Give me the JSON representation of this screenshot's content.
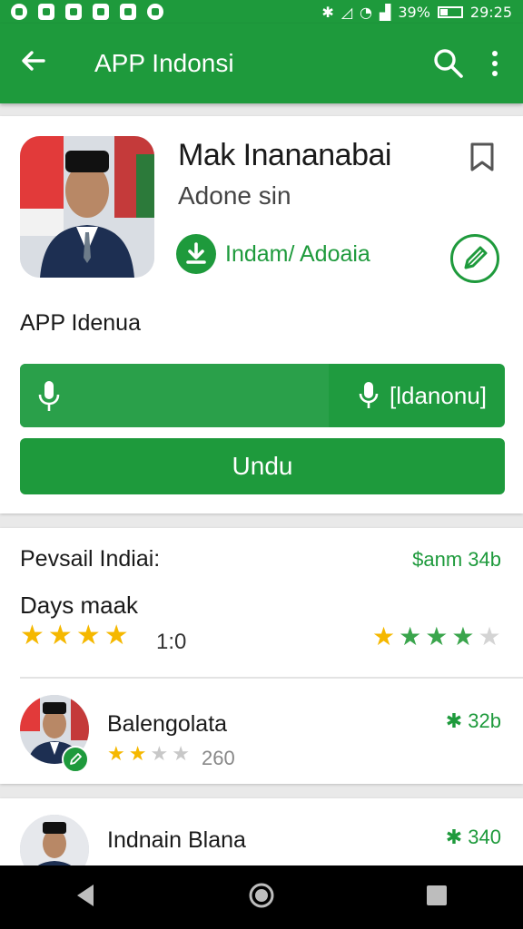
{
  "status_bar": {
    "battery": "39%",
    "time": "29:25",
    "icons": [
      "whatsapp-icon",
      "message-icon",
      "sim-icon",
      "home-icon",
      "instagram-icon",
      "record-icon"
    ],
    "right_icons": [
      "bluetooth-icon",
      "mute-icon",
      "wifi-icon",
      "signal-icon",
      "battery-icon"
    ]
  },
  "app_bar": {
    "title": "APP Indonsi",
    "back_icon": "arrow-left-icon",
    "search_icon": "search-icon",
    "more_icon": "more-vertical-icon"
  },
  "app_card": {
    "name": "Mak Inananabai",
    "developer": "Adone sin",
    "download_label": "Indam/ Adoaia",
    "subtitle": "APP Idenua",
    "mic_button_label": "[ldanonu]",
    "primary_button_label": "Undu"
  },
  "reviews": {
    "title": "Pevsail Indiai:",
    "price": "$anm 34b",
    "subtitle": "Days maak",
    "rating_value": "1:0",
    "left_stars": 4,
    "right_stars": 4
  },
  "review_rows": [
    {
      "name": "Balengolata",
      "count": "260",
      "score": "32b",
      "stars": 2
    },
    {
      "name": "Indnain Blana",
      "score": "340"
    }
  ],
  "colors": {
    "accent": "#1e9a3c",
    "star_gold": "#f5b800",
    "star_green": "#3aa54c"
  }
}
